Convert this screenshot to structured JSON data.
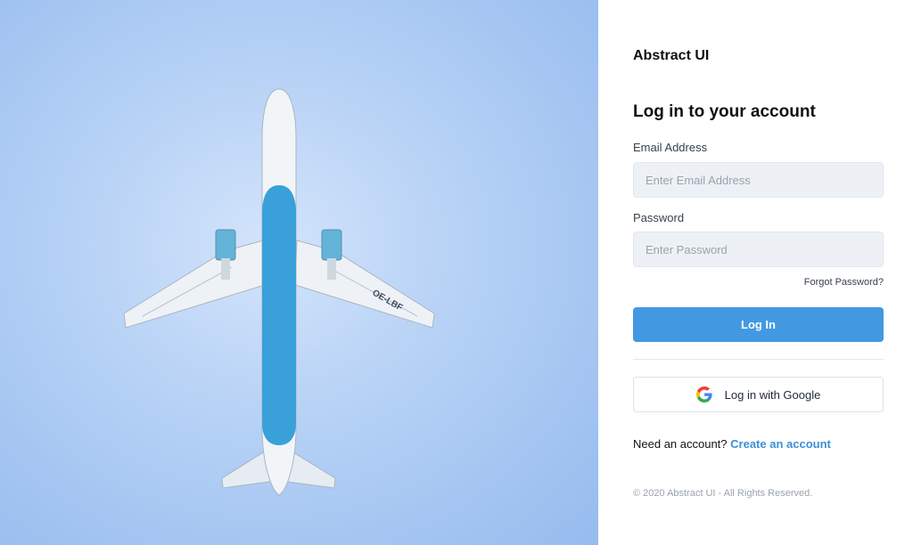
{
  "brand": "Abstract UI",
  "heading": "Log in to your account",
  "email": {
    "label": "Email Address",
    "placeholder": "Enter Email Address"
  },
  "password": {
    "label": "Password",
    "placeholder": "Enter Password"
  },
  "forgot_label": "Forgot Password?",
  "login_label": "Log In",
  "google_label": "Log in with Google",
  "signup": {
    "prompt": "Need an account? ",
    "link": "Create an account"
  },
  "footer": "© 2020 Abstract UI - All Rights Reserved.",
  "hero": {
    "registration": "OE-LBF",
    "icon": "airplane-photo"
  },
  "colors": {
    "accent": "#4299e1",
    "link": "#3b8fd6",
    "input_bg": "#edf1f6",
    "sky": "#b4d0f5",
    "fuselage_blue": "#3aa0da"
  }
}
